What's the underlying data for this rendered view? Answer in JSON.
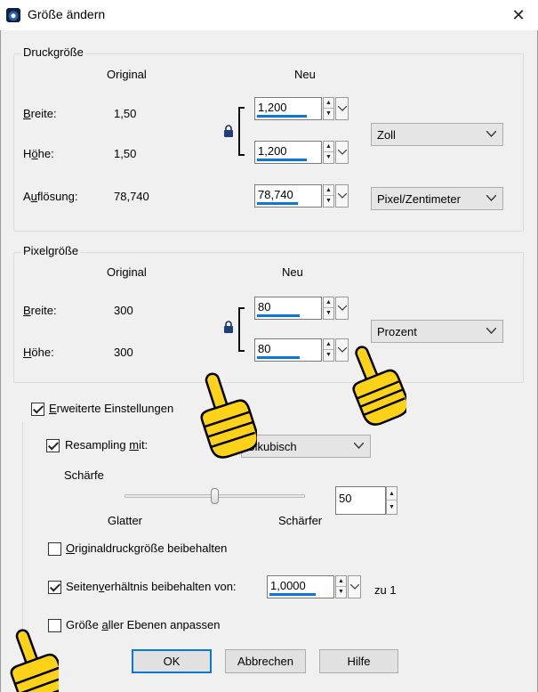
{
  "window": {
    "title": "Größe ändern",
    "close_glyph": "✕"
  },
  "print_size": {
    "group_title": "Druckgröße",
    "col_original": "Original",
    "col_new": "Neu",
    "width_label": "Breite:",
    "height_label": "Höhe:",
    "resolution_label": "Auflösung:",
    "width_original": "1,50",
    "height_original": "1,50",
    "resolution_original": "78,740",
    "width_new": "1,200",
    "height_new": "1,200",
    "resolution_new": "78,740",
    "unit": "Zoll",
    "resolution_unit": "Pixel/Zentimeter"
  },
  "pixel_size": {
    "group_title": "Pixelgröße",
    "col_original": "Original",
    "col_new": "Neu",
    "width_label": "Breite:",
    "height_label": "Höhe:",
    "width_original": "300",
    "height_original": "300",
    "width_new": "80",
    "height_new": "80",
    "unit": "Prozent"
  },
  "advanced": {
    "label": "Erweiterte Einstellungen",
    "checked": true,
    "resampling_label": "Resampling mit:",
    "resampling_checked": true,
    "resampling_method": "Bikubisch",
    "sharpness_label": "Schärfe",
    "slider_left_label": "Glatter",
    "slider_right_label": "Schärfer",
    "sharpness_value": "50",
    "sharpness_fraction": 0.5,
    "keep_original_print_size_label": "Originaldruckgröße beibehalten",
    "keep_original_print_size_checked": false,
    "keep_aspect_label": "Seitenverhältnis beibehalten von:",
    "keep_aspect_checked": true,
    "aspect_value": "1,0000",
    "aspect_suffix": "zu 1",
    "resize_all_layers_label": "Größe aller Ebenen anpassen",
    "resize_all_layers_checked": false
  },
  "buttons": {
    "ok": "OK",
    "cancel": "Abbrechen",
    "help": "Hilfe"
  },
  "colors": {
    "accent": "#0a78d7",
    "window_bg": "#f0f0f0",
    "pointer_yellow": "#ffd21a"
  },
  "icons": [
    "app-icon",
    "close-icon",
    "lock-icon",
    "pointing-hand-icon"
  ]
}
